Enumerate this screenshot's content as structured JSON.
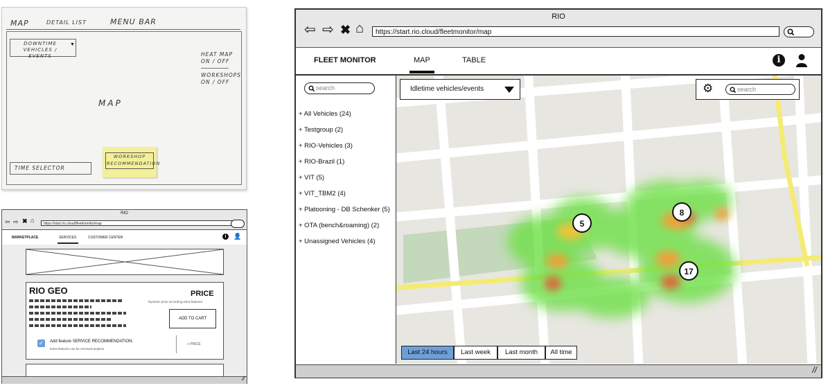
{
  "sketch": {
    "menubar": [
      "MAP",
      "DETAIL LIST",
      "MENU BAR"
    ],
    "dropdown": "DOWNTIME VEHICLES / EVENTS",
    "heatmap_toggle": "HEAT MAP ON / OFF",
    "workshops_toggle": "WORKSHOPS ON / OFF",
    "map_label": "MAP",
    "time_selector": "TIME SELECTOR",
    "sticky_note": "WORKSHOP RECOMMENDATION"
  },
  "mini": {
    "window_title": "RIO",
    "url": "https://start.rio.cloud/fleetmonitor/map",
    "nav": [
      "MARKETPLACE",
      "SERVICES",
      "CUSTOMER CENTER"
    ],
    "product_title": "RIO GEO",
    "price_label": "PRICE",
    "price_note": "Dynamic price according extra features",
    "add_to_cart": "ADD TO CART",
    "feature_label": "Add feature SERVICE RECOMMENDATION.",
    "feature_sub": "Extra features can be removed anytime",
    "plus_price": "+ PRICE"
  },
  "window": {
    "title": "RIO",
    "url": "https://start.rio.cloud/fleetmonitor/map"
  },
  "nav": {
    "brand": "FLEET MONITOR",
    "tabs": [
      "MAP",
      "TABLE"
    ]
  },
  "sidebar": {
    "search_placeholder": "search",
    "items": [
      "+ All Vehicles (24)",
      "+ Testgroup (2)",
      "+ RIO-Vehicles (3)",
      "+ RIO-Brazil (1)",
      "+ VIT (5)",
      "+ VIT_TBM2 (4)",
      "+ Platooning - DB Schenker (5)",
      "+ OTA (bench&roaming) (2)",
      "+ Unassigned Vehicles (4)"
    ]
  },
  "map": {
    "dropdown_value": "Idletime vehicles/events",
    "search_placeholder": "search",
    "clusters": [
      "5",
      "8",
      "17"
    ],
    "time_options": [
      "Last 24 hours",
      "Last week",
      "Last month",
      "All time"
    ],
    "selected_time": "Last 24 hours"
  }
}
